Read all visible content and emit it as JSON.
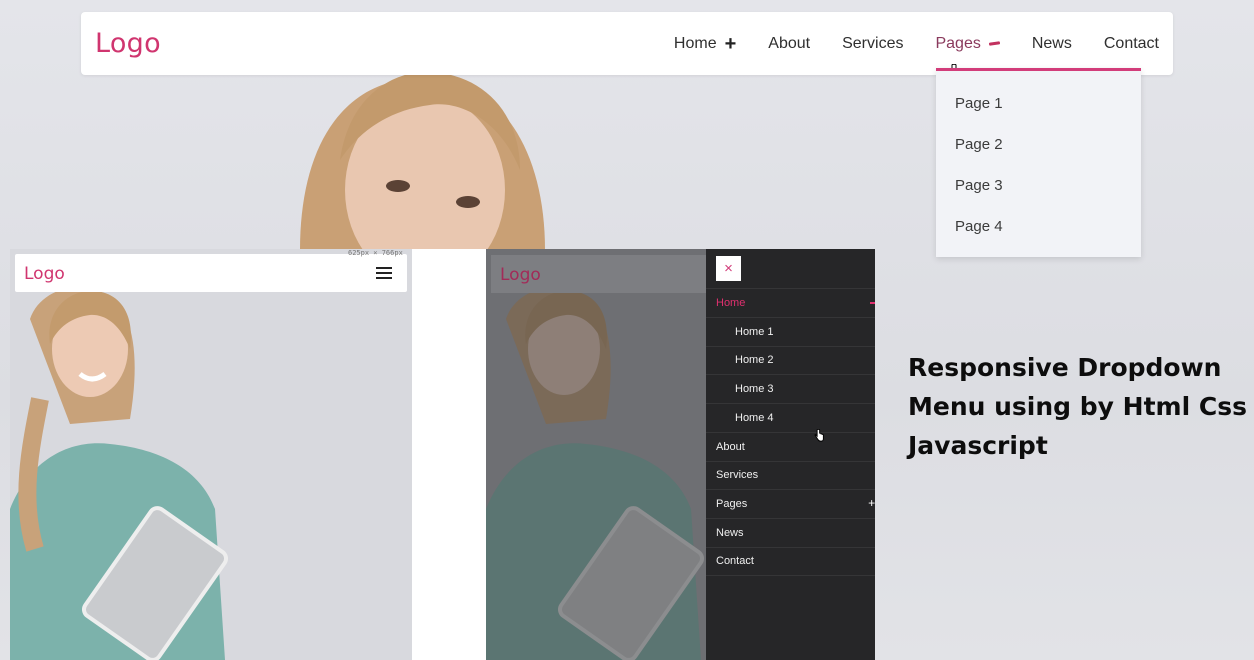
{
  "desktop": {
    "logo": "Logo",
    "nav": [
      {
        "label": "Home",
        "indicator": "plus"
      },
      {
        "label": "About"
      },
      {
        "label": "Services"
      },
      {
        "label": "Pages",
        "indicator": "minus",
        "active": true
      },
      {
        "label": "News"
      },
      {
        "label": "Contact"
      }
    ],
    "dropdown": [
      "Page 1",
      "Page 2",
      "Page 3",
      "Page 4"
    ]
  },
  "mobile_closed": {
    "logo": "Logo",
    "viewport_label": "625px × 766px",
    "menu_icon": "hamburger-icon"
  },
  "mobile_open": {
    "logo": "Logo",
    "close_icon": "×",
    "menu": [
      {
        "label": "Home",
        "active": true
      },
      {
        "label": "Home 1",
        "sub": true
      },
      {
        "label": "Home 2",
        "sub": true
      },
      {
        "label": "Home 3",
        "sub": true
      },
      {
        "label": "Home 4",
        "sub": true
      },
      {
        "label": "About"
      },
      {
        "label": "Services"
      },
      {
        "label": "Pages"
      },
      {
        "label": "News"
      },
      {
        "label": "Contact"
      }
    ]
  },
  "caption": {
    "line1": "Responsive Dropdown",
    "line2": "Menu using by Html Css",
    "line3": "Javascript"
  },
  "colors": {
    "accent": "#d0356f",
    "drawer_bg": "#262628"
  }
}
